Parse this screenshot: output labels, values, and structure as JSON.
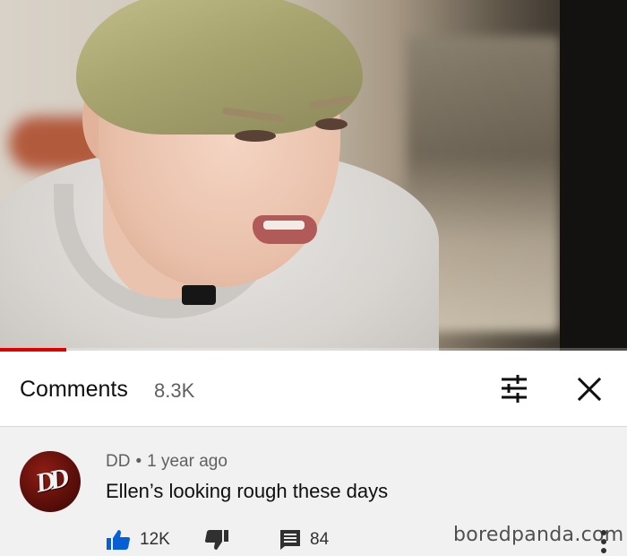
{
  "video": {
    "progress_fraction": 0.105,
    "progress_color": "#e00000"
  },
  "comments_header": {
    "title": "Comments",
    "count": "8.3K",
    "sort_icon": "sort-filter-icon",
    "close_icon": "close-icon"
  },
  "comment": {
    "avatar_text": "DD",
    "author": "DD",
    "separator": "•",
    "time": "1 year ago",
    "text": "Ellen’s looking rough these days",
    "likes": "12K",
    "replies": "84",
    "like_icon": "thumbs-up-icon",
    "dislike_icon": "thumbs-down-icon",
    "reply_icon": "reply-icon",
    "more_icon": "more-vertical-icon"
  },
  "watermark": "boredpanda.com",
  "colors": {
    "accent_like": "#065fd4",
    "text_primary": "#0f0f0f",
    "text_secondary": "#606060",
    "comment_bg": "#f1f1f1"
  }
}
